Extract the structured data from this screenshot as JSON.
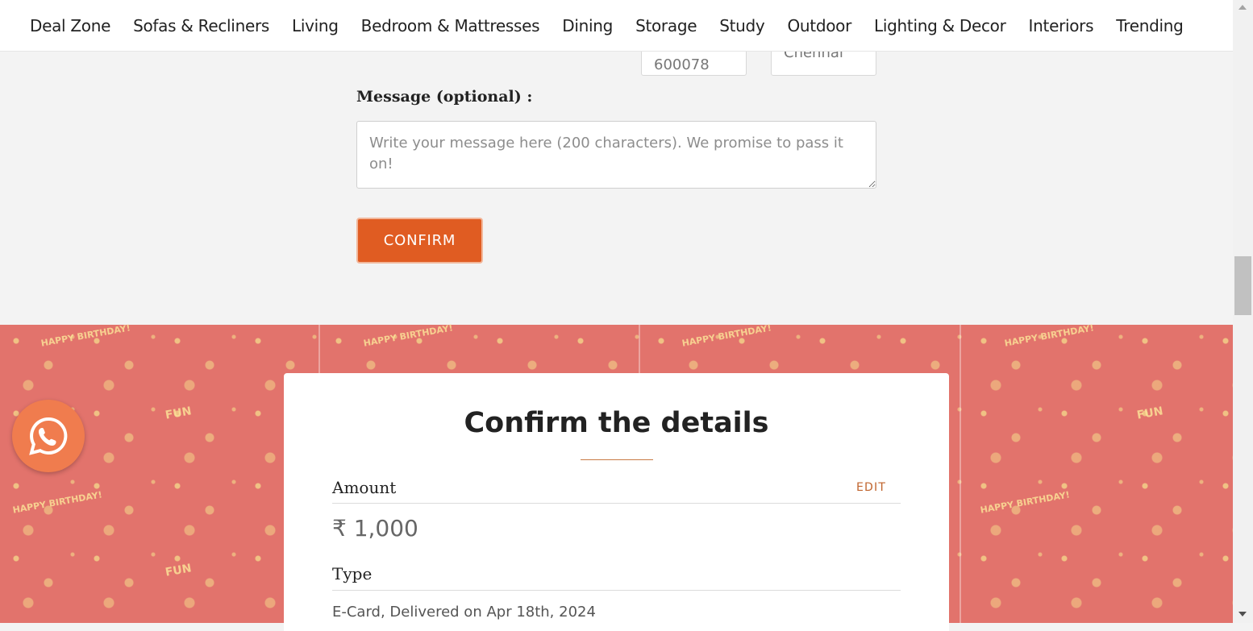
{
  "nav": {
    "items": [
      "Deal Zone",
      "Sofas & Recliners",
      "Living",
      "Bedroom & Mattresses",
      "Dining",
      "Storage",
      "Study",
      "Outdoor",
      "Lighting & Decor",
      "Interiors",
      "Trending"
    ]
  },
  "form": {
    "pincode_value": "600078",
    "city_value": "Chennai",
    "message_label": "Message (optional) :",
    "message_placeholder": "Write your message here (200 characters). We promise to pass it on!",
    "confirm_label": "CONFIRM"
  },
  "pattern": {
    "text": "HAPPY BIRTHDAY!",
    "fun_text": "FUN"
  },
  "details": {
    "title": "Confirm the details",
    "amount_label": "Amount",
    "edit_label": "EDIT",
    "amount_value": "₹ 1,000",
    "type_label": "Type",
    "type_value": "E-Card, Delivered on Apr 18th, 2024"
  },
  "colors": {
    "accent": "#e05c22",
    "pattern_bg": "#e2736c",
    "whatsapp_bg": "#f07c4e"
  },
  "icons": {
    "whatsapp": "whatsapp-icon"
  }
}
